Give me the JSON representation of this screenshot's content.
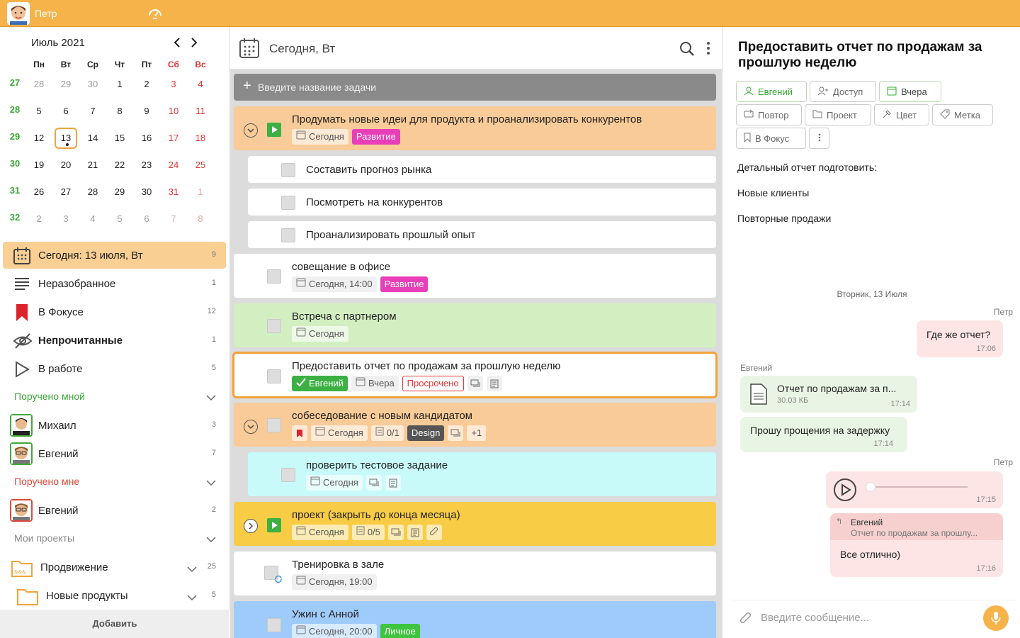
{
  "topbar": {
    "user_name": "Петр"
  },
  "calendar": {
    "month_label": "Июль 2021",
    "weekdays": [
      "Пн",
      "Вт",
      "Ср",
      "Чт",
      "Пт",
      "Сб",
      "Вс"
    ],
    "weeks": [
      {
        "num": "27",
        "days": [
          "28",
          "29",
          "30",
          "1",
          "2",
          "3",
          "4"
        ]
      },
      {
        "num": "28",
        "days": [
          "5",
          "6",
          "7",
          "8",
          "9",
          "10",
          "11"
        ]
      },
      {
        "num": "29",
        "days": [
          "12",
          "13",
          "14",
          "15",
          "16",
          "17",
          "18"
        ]
      },
      {
        "num": "30",
        "days": [
          "19",
          "20",
          "21",
          "22",
          "23",
          "24",
          "25"
        ]
      },
      {
        "num": "31",
        "days": [
          "26",
          "27",
          "28",
          "29",
          "30",
          "31",
          "1"
        ]
      },
      {
        "num": "32",
        "days": [
          "2",
          "3",
          "4",
          "5",
          "6",
          "7",
          "8"
        ]
      }
    ]
  },
  "nav": [
    {
      "label": "Сегодня: 13 июля, Вт",
      "count": "9"
    },
    {
      "label": "Неразобранное",
      "count": "1"
    },
    {
      "label": "В Фокусе",
      "count": "12"
    },
    {
      "label": "Непрочитанные",
      "count": "1"
    },
    {
      "label": "В работе",
      "count": "5"
    }
  ],
  "sections": {
    "assigned_by_me": "Поручено мной",
    "assigned_to_me": "Поручено мне",
    "my_projects": "Мои проекты"
  },
  "people_by_me": [
    {
      "name": "Михаил",
      "count": "3"
    },
    {
      "name": "Евгений",
      "count": "7"
    }
  ],
  "people_to_me": [
    {
      "name": "Евгений",
      "count": "2"
    }
  ],
  "projects": [
    {
      "name": "Продвижение",
      "count": "25"
    },
    {
      "name": "Новые продукты",
      "count": "5"
    }
  ],
  "add_label": "Добавить",
  "middle": {
    "title": "Сегодня, Вт",
    "new_task_placeholder": "Введите название задачи"
  },
  "tasks": {
    "t1": {
      "title": "Продумать новые идеи для продукта и проанализировать конкурентов",
      "date": "Сегодня",
      "tag": "Развитие"
    },
    "s1": {
      "title": "Составить прогноз рынка"
    },
    "s2": {
      "title": "Посмотреть на конкурентов"
    },
    "s3": {
      "title": "Проанализировать прошлый опыт"
    },
    "t2": {
      "title": "совещание в офисе",
      "date": "Сегодня, 14:00",
      "tag": "Развитие"
    },
    "t3": {
      "title": "Встреча с партнером",
      "date": "Сегодня"
    },
    "t4": {
      "title": "Предоставить отчет по продажам за прошлую неделю",
      "assignee": "Евгений",
      "date": "Вчера",
      "status": "Просрочено"
    },
    "t5": {
      "title": "собеседование с новым кандидатом",
      "date": "Сегодня",
      "checklist": "0/1",
      "tag": "Design",
      "more": "+1"
    },
    "t5a": {
      "title": "проверить тестовое задание",
      "date": "Сегодня"
    },
    "t6": {
      "title": "проект (закрыть до конца месяца)",
      "date": "Сегодня",
      "checklist": "0/5"
    },
    "t7": {
      "title": "Тренировка в зале",
      "date": "Сегодня, 19:00"
    },
    "t8": {
      "title": "Ужин с Анной",
      "date": "Сегодня, 20:00",
      "tag": "Личное"
    }
  },
  "detail": {
    "title": "Предоставить отчет по продажам за прошлую неделю",
    "buttons": {
      "assignee": "Евгений",
      "access": "Доступ",
      "date": "Вчера",
      "repeat": "Повтор",
      "project": "Проект",
      "color": "Цвет",
      "label": "Метка",
      "focus": "В Фокус"
    },
    "notes": [
      "Детальный отчет подготовить:",
      "Новые клиенты",
      "Повторные продажи"
    ]
  },
  "chat": {
    "date": "Вторник, 13 Июля",
    "m1": {
      "author": "Петр",
      "text": "Где же отчет?",
      "time": "17:06"
    },
    "m2": {
      "author": "Евгений",
      "file": "Отчет по продажам за п...",
      "size": "30.03 КБ",
      "time": "17:14"
    },
    "m3": {
      "text": "Прошу прощения на задержку",
      "time": "17:14"
    },
    "m4": {
      "author": "Петр",
      "time": "17:15"
    },
    "m5": {
      "reply_author": "Евгений",
      "reply_text": "Отчет по продажам за прошлу...",
      "text": "Все отлично)",
      "time": "17:16"
    },
    "input_placeholder": "Введите сообщение..."
  },
  "colors": {
    "accent": "#f6b34a",
    "orange_task": "#f9cb98",
    "green_task": "#d3efc2",
    "cyan_task": "#c8fafa",
    "yellow_task": "#f8cc45",
    "blue_task": "#9ecbfa",
    "pink_tag": "#e83fb8",
    "green_tag": "#3cb043"
  }
}
